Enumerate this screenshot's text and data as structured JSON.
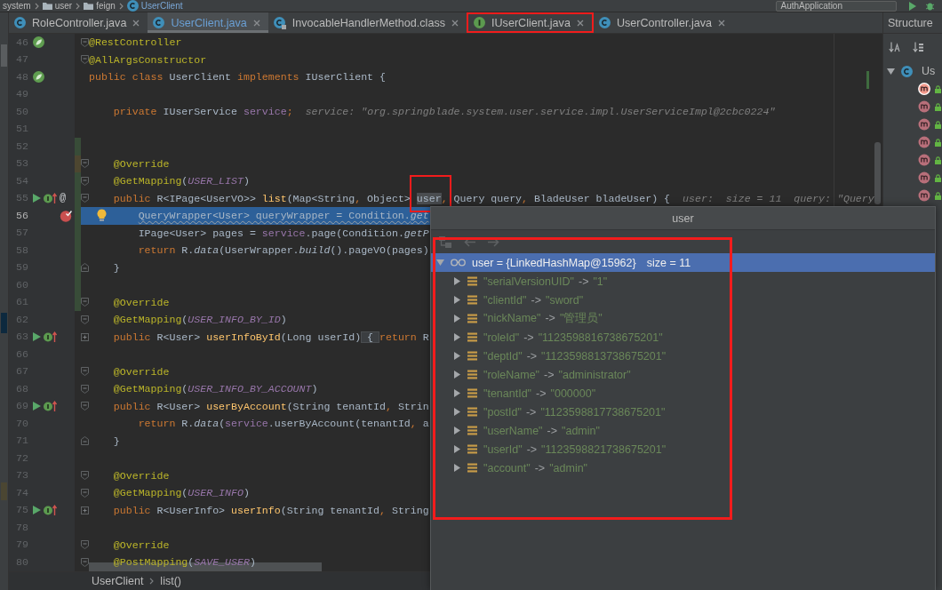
{
  "navigation_bar": {
    "items": [
      {
        "kind": "text",
        "label": "system"
      },
      {
        "kind": "folder",
        "label": "user"
      },
      {
        "kind": "folder",
        "label": "feign"
      },
      {
        "kind": "class",
        "label": "UserClient"
      }
    ],
    "run_configuration": "AuthApplication"
  },
  "tabs": [
    {
      "label": "RoleController.java",
      "kind": "class",
      "selected": false,
      "modified": false,
      "annotated": false
    },
    {
      "label": "UserClient.java",
      "kind": "class",
      "selected": true,
      "modified": true,
      "annotated": false
    },
    {
      "label": "InvocableHandlerMethod.class",
      "kind": "compiled",
      "selected": false,
      "modified": false,
      "annotated": false
    },
    {
      "label": "IUserClient.java",
      "kind": "interface",
      "selected": false,
      "modified": false,
      "annotated": true
    },
    {
      "label": "UserController.java",
      "kind": "class",
      "selected": false,
      "modified": false,
      "annotated": false
    }
  ],
  "editor": {
    "lines": [
      {
        "number": "46",
        "gutter": [
          {
            "kind": "bean"
          }
        ],
        "fold": {
          "kind": "start"
        },
        "code": [
          {
            "kind": "annotation",
            "text": "@RestController"
          }
        ]
      },
      {
        "number": "47",
        "fold": {
          "kind": "start"
        },
        "code": [
          {
            "kind": "annotation",
            "text": "@AllArgsConstructor"
          }
        ]
      },
      {
        "number": "48",
        "gutter": [
          {
            "kind": "bean"
          }
        ],
        "code": [
          {
            "kind": "keyword",
            "text": "public class "
          },
          {
            "kind": "plain",
            "text": "UserClient "
          },
          {
            "kind": "keyword",
            "text": "implements "
          },
          {
            "kind": "plain",
            "text": "IUserClient {"
          }
        ],
        "children": [
          {
            "number": "49"
          },
          {
            "number": "50",
            "code": [
              {
                "kind": "keyword",
                "text": "private "
              },
              {
                "kind": "plain",
                "text": "IUserService "
              },
              {
                "kind": "field",
                "text": "service"
              },
              {
                "kind": "keyword",
                "text": ";"
              }
            ],
            "debug_value": "service: \"org.springblade.system.user.service.impl.UserServiceImpl@2cbc0224\""
          },
          {
            "number": "51"
          },
          {
            "number": "52",
            "vcs": {
              "kind": "added"
            }
          },
          {
            "number": "53",
            "vcs": {
              "kind": "modified"
            },
            "fold": {
              "kind": "start"
            },
            "code": [
              {
                "kind": "annotation",
                "text": "@Override"
              }
            ]
          },
          {
            "number": "54",
            "vcs": {
              "kind": "added"
            },
            "fold": {
              "kind": "start"
            },
            "code": [
              {
                "kind": "annotation",
                "text": "@GetMapping"
              },
              {
                "kind": "plain",
                "text": "("
              },
              {
                "kind": "constant",
                "text": "USER_LIST"
              },
              {
                "kind": "plain",
                "text": ")"
              }
            ]
          },
          {
            "number": "55",
            "vcs": {
              "kind": "added"
            },
            "gutter": [
              {
                "kind": "run"
              },
              {
                "kind": "implements"
              },
              {
                "kind": "symbol",
                "text": "@"
              }
            ],
            "fold": {
              "kind": "start"
            },
            "code": [
              {
                "kind": "keyword",
                "text": "public ",
                "hovered": false,
                "annotated": false
              },
              {
                "kind": "plain",
                "text": "R<IPage<UserVO>> ",
                "hovered": false,
                "annotated": false
              },
              {
                "kind": "declaration",
                "text": "list",
                "hovered": false,
                "annotated": false
              },
              {
                "kind": "plain",
                "text": "(Map<String",
                "hovered": false,
                "annotated": false
              },
              {
                "kind": "keyword",
                "text": ", ",
                "hovered": false,
                "annotated": false
              },
              {
                "kind": "plain",
                "text": "Object> ",
                "hovered": false,
                "annotated": false
              },
              {
                "kind": "plain",
                "text": "user",
                "hovered": true,
                "annotated": true
              },
              {
                "kind": "keyword",
                "text": ", ",
                "hovered": false,
                "annotated": false
              },
              {
                "kind": "plain",
                "text": "Query query",
                "hovered": false,
                "annotated": false
              },
              {
                "kind": "keyword",
                "text": ", ",
                "hovered": false,
                "annotated": false
              },
              {
                "kind": "plain",
                "text": "BladeUser bladeUser) {",
                "hovered": false,
                "annotated": false
              }
            ],
            "debug_value": "user:  size = 11  query: \"Query",
            "children": [
              {
                "number": "56",
                "vcs": {
                  "kind": "added"
                },
                "gutter": [
                  {
                    "kind": "breakpoint"
                  }
                ],
                "highlight": {
                  "kind": "execution"
                },
                "intention": {
                  "kind": "bulb"
                },
                "code": [
                  {
                    "kind": "plain",
                    "text": "QueryWrapper<User> queryWrapper = Condition."
                  },
                  {
                    "kind": "static-call",
                    "text": "get"
                  }
                ]
              },
              {
                "number": "57",
                "vcs": {
                  "kind": "added"
                },
                "code": [
                  {
                    "kind": "plain",
                    "text": "IPage<User> pages = "
                  },
                  {
                    "kind": "field",
                    "text": "service"
                  },
                  {
                    "kind": "plain",
                    "text": ".page(Condition."
                  },
                  {
                    "kind": "static-call",
                    "text": "getP"
                  }
                ]
              },
              {
                "number": "58",
                "vcs": {
                  "kind": "added"
                },
                "code": [
                  {
                    "kind": "keyword",
                    "text": "return "
                  },
                  {
                    "kind": "plain",
                    "text": "R."
                  },
                  {
                    "kind": "static-call",
                    "text": "data"
                  },
                  {
                    "kind": "plain",
                    "text": "(UserWrapper."
                  },
                  {
                    "kind": "static-call",
                    "text": "build"
                  },
                  {
                    "kind": "plain",
                    "text": "().pageVO(pages)"
                  }
                ]
              }
            ]
          },
          {
            "number": "59",
            "vcs": {
              "kind": "added"
            },
            "fold": {
              "kind": "end"
            },
            "code": [
              {
                "kind": "plain",
                "text": "}"
              }
            ]
          },
          {
            "number": "60",
            "vcs": {
              "kind": "added"
            }
          },
          {
            "number": "61",
            "vcs": {
              "kind": "added"
            },
            "fold": {
              "kind": "start"
            },
            "code": [
              {
                "kind": "annotation",
                "text": "@Override"
              }
            ]
          },
          {
            "number": "62",
            "fold": {
              "kind": "start"
            },
            "code": [
              {
                "kind": "annotation",
                "text": "@GetMapping"
              },
              {
                "kind": "plain",
                "text": "("
              },
              {
                "kind": "constant",
                "text": "USER_INFO_BY_ID"
              },
              {
                "kind": "plain",
                "text": ")"
              }
            ]
          },
          {
            "number": "63",
            "gutter": [
              {
                "kind": "run"
              },
              {
                "kind": "implements"
              }
            ],
            "fold": {
              "kind": "collapsed"
            },
            "code": [
              {
                "kind": "keyword",
                "text": "public "
              },
              {
                "kind": "plain",
                "text": "R<User> "
              },
              {
                "kind": "declaration",
                "text": "userInfoById"
              },
              {
                "kind": "plain",
                "text": "(Long userId)"
              },
              {
                "kind": "folded",
                "text": " { "
              },
              {
                "kind": "keyword",
                "text": "return "
              },
              {
                "kind": "plain",
                "text": "R"
              }
            ]
          },
          {
            "number": "66"
          },
          {
            "number": "67",
            "fold": {
              "kind": "start"
            },
            "code": [
              {
                "kind": "annotation",
                "text": "@Override"
              }
            ]
          },
          {
            "number": "68",
            "fold": {
              "kind": "start"
            },
            "code": [
              {
                "kind": "annotation",
                "text": "@GetMapping"
              },
              {
                "kind": "plain",
                "text": "("
              },
              {
                "kind": "constant",
                "text": "USER_INFO_BY_ACCOUNT"
              },
              {
                "kind": "plain",
                "text": ")"
              }
            ]
          },
          {
            "number": "69",
            "gutter": [
              {
                "kind": "run"
              },
              {
                "kind": "implements"
              }
            ],
            "fold": {
              "kind": "start"
            },
            "code": [
              {
                "kind": "keyword",
                "text": "public "
              },
              {
                "kind": "plain",
                "text": "R<User> "
              },
              {
                "kind": "declaration",
                "text": "userByAccount"
              },
              {
                "kind": "plain",
                "text": "(String tenantId"
              },
              {
                "kind": "keyword",
                "text": ", "
              },
              {
                "kind": "plain",
                "text": "Strin"
              }
            ],
            "children": [
              {
                "number": "70",
                "code": [
                  {
                    "kind": "keyword",
                    "text": "return "
                  },
                  {
                    "kind": "plain",
                    "text": "R."
                  },
                  {
                    "kind": "static-call",
                    "text": "data"
                  },
                  {
                    "kind": "plain",
                    "text": "("
                  },
                  {
                    "kind": "field",
                    "text": "service"
                  },
                  {
                    "kind": "plain",
                    "text": ".userByAccount(tenantId"
                  },
                  {
                    "kind": "keyword",
                    "text": ", "
                  },
                  {
                    "kind": "plain",
                    "text": "a"
                  }
                ]
              }
            ]
          },
          {
            "number": "71",
            "fold": {
              "kind": "end"
            },
            "code": [
              {
                "kind": "plain",
                "text": "}"
              }
            ]
          },
          {
            "number": "72"
          },
          {
            "number": "73",
            "fold": {
              "kind": "start"
            },
            "code": [
              {
                "kind": "annotation",
                "text": "@Override"
              }
            ]
          },
          {
            "number": "74",
            "fold": {
              "kind": "start"
            },
            "code": [
              {
                "kind": "annotation",
                "text": "@GetMapping"
              },
              {
                "kind": "plain",
                "text": "("
              },
              {
                "kind": "constant",
                "text": "USER_INFO"
              },
              {
                "kind": "plain",
                "text": ")"
              }
            ]
          },
          {
            "number": "75",
            "gutter": [
              {
                "kind": "run"
              },
              {
                "kind": "implements"
              }
            ],
            "fold": {
              "kind": "collapsed"
            },
            "code": [
              {
                "kind": "keyword",
                "text": "public "
              },
              {
                "kind": "plain",
                "text": "R<UserInfo> "
              },
              {
                "kind": "declaration",
                "text": "userInfo"
              },
              {
                "kind": "plain",
                "text": "(String tenantId"
              },
              {
                "kind": "keyword",
                "text": ", "
              },
              {
                "kind": "plain",
                "text": "String"
              }
            ]
          },
          {
            "number": "78"
          },
          {
            "number": "79",
            "fold": {
              "kind": "start"
            },
            "code": [
              {
                "kind": "annotation",
                "text": "@Override"
              }
            ]
          },
          {
            "number": "80",
            "fold": {
              "kind": "start"
            },
            "code": [
              {
                "kind": "annotation",
                "text": "@PostMapping"
              },
              {
                "kind": "plain",
                "text": "("
              },
              {
                "kind": "constant",
                "text": "SAVE_USER"
              },
              {
                "kind": "plain",
                "text": ")"
              }
            ]
          }
        ]
      }
    ]
  },
  "editor_breadcrumb": [
    "UserClient",
    "list()"
  ],
  "structure": {
    "title": "Structure",
    "toolbar": [
      {
        "kind": "sort-alpha"
      },
      {
        "kind": "sort-visibility"
      }
    ],
    "root": {
      "label": "Us",
      "expanded": true,
      "children": [
        {
          "selected": true
        },
        {
          "selected": false
        },
        {
          "selected": false
        },
        {
          "selected": false
        },
        {
          "selected": false
        },
        {
          "selected": false
        },
        {
          "selected": false
        }
      ]
    }
  },
  "debug_popup": {
    "title": "user",
    "annotated": true,
    "toolbar": [
      {
        "kind": "hierarchy",
        "disabled": true
      },
      {
        "kind": "back",
        "disabled": true
      },
      {
        "kind": "forward",
        "disabled": true
      }
    ],
    "root": {
      "label": "user = {LinkedHashMap@15962}",
      "size": "size = 11",
      "expanded": true,
      "selected": true,
      "children": [
        {
          "key": "\"serialVersionUID\"",
          "arrow": "->",
          "value": "\"1\"",
          "expanded": false,
          "selected": false
        },
        {
          "key": "\"clientId\"",
          "arrow": "->",
          "value": "\"sword\"",
          "expanded": false,
          "selected": false
        },
        {
          "key": "\"nickName\"",
          "arrow": "->",
          "value": "\"管理员\"",
          "expanded": false,
          "selected": false
        },
        {
          "key": "\"roleId\"",
          "arrow": "->",
          "value": "\"1123598816738675201\"",
          "expanded": false,
          "selected": false
        },
        {
          "key": "\"deptId\"",
          "arrow": "->",
          "value": "\"1123598813738675201\"",
          "expanded": false,
          "selected": false
        },
        {
          "key": "\"roleName\"",
          "arrow": "->",
          "value": "\"administrator\"",
          "expanded": false,
          "selected": false
        },
        {
          "key": "\"tenantId\"",
          "arrow": "->",
          "value": "\"000000\"",
          "expanded": false,
          "selected": false
        },
        {
          "key": "\"postId\"",
          "arrow": "->",
          "value": "\"1123598817738675201\"",
          "expanded": false,
          "selected": false
        },
        {
          "key": "\"userName\"",
          "arrow": "->",
          "value": "\"admin\"",
          "expanded": false,
          "selected": false
        },
        {
          "key": "\"userId\"",
          "arrow": "->",
          "value": "\"1123598821738675201\"",
          "expanded": false,
          "selected": false
        },
        {
          "key": "\"account\"",
          "arrow": "->",
          "value": "\"admin\"",
          "expanded": false,
          "selected": false
        }
      ]
    }
  }
}
